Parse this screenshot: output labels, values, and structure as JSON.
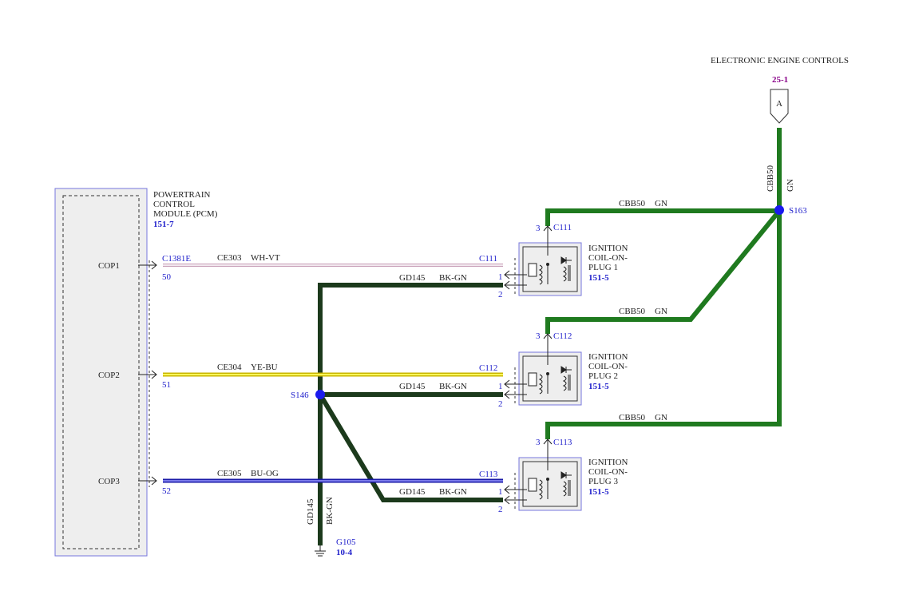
{
  "header": {
    "title": "ELECTRONIC ENGINE CONTROLS",
    "ref": "25-1",
    "connector_letter": "A"
  },
  "pcm": {
    "name_lines": [
      "POWERTRAIN",
      "CONTROL",
      "MODULE (PCM)"
    ],
    "ref": "151-7",
    "pins": [
      {
        "label": "COP1",
        "pin": "50"
      },
      {
        "label": "COP2",
        "pin": "51"
      },
      {
        "label": "COP3",
        "pin": "52"
      }
    ]
  },
  "pcm_connector": "C1381E",
  "circuits": [
    {
      "id": "CE303",
      "color": "WH-VT",
      "connector": "C111"
    },
    {
      "id": "CE304",
      "color": "YE-BU",
      "connector": "C112"
    },
    {
      "id": "CE305",
      "color": "BU-OG",
      "connector": "C113"
    }
  ],
  "ground_circuit": {
    "id": "GD145",
    "color": "BK-GN"
  },
  "power_circuit": {
    "id": "CBB50",
    "color": "GN"
  },
  "splices": {
    "power": "S163",
    "ground": "S146"
  },
  "ground": {
    "name": "G105",
    "ref": "10-4"
  },
  "coils": [
    {
      "name_lines": [
        "IGNITION",
        "COIL-ON-",
        "PLUG 1"
      ],
      "ref": "151-5",
      "connector": "C111",
      "pins": [
        "3",
        "1",
        "2"
      ]
    },
    {
      "name_lines": [
        "IGNITION",
        "COIL-ON-",
        "PLUG 2"
      ],
      "ref": "151-5",
      "connector": "C112",
      "pins": [
        "3",
        "1",
        "2"
      ]
    },
    {
      "name_lines": [
        "IGNITION",
        "COIL-ON-",
        "PLUG 3"
      ],
      "ref": "151-5",
      "connector": "C113",
      "pins": [
        "3",
        "1",
        "2"
      ]
    }
  ],
  "colors": {
    "power_wire": "#1f7a1f",
    "ground_wire": "#1c3a1c",
    "label_blue": "#2222cc",
    "ref_purple": "#880088",
    "module_border": "#7777dd"
  }
}
